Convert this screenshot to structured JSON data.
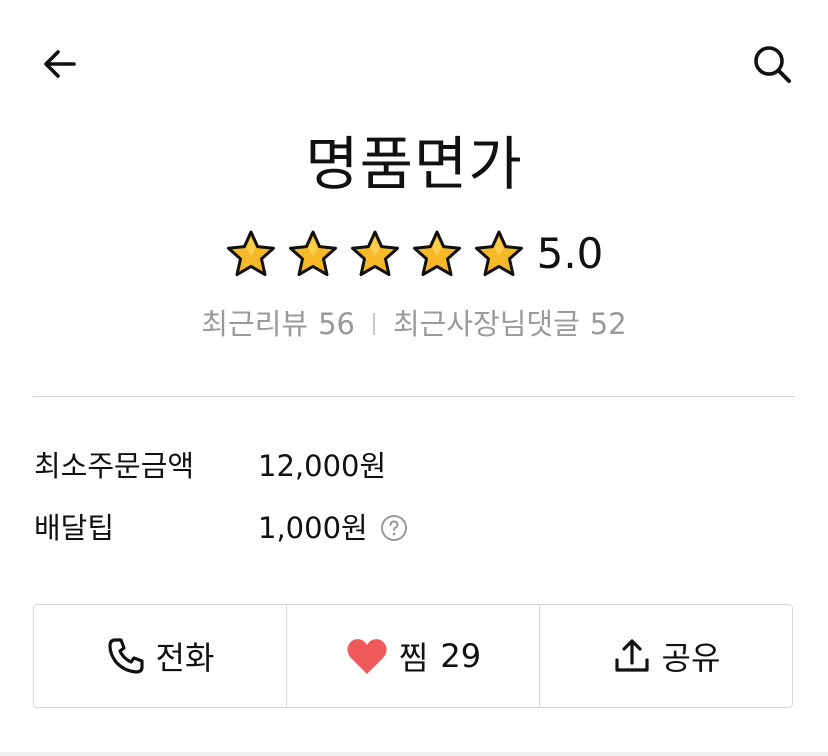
{
  "header": {
    "back_icon": "arrow-left-icon",
    "search_icon": "search-icon"
  },
  "store": {
    "name": "명품면가",
    "rating": 5.0,
    "rating_text": "5.0",
    "stars": 5,
    "star_color": "#f7b928"
  },
  "reviews": {
    "recent_label": "최근리뷰",
    "recent_count": "56",
    "owner_label": "최근사장님댓글",
    "owner_count": "52"
  },
  "info": {
    "min_order_label": "최소주문금액",
    "min_order_value": "12,000원",
    "delivery_tip_label": "배달팁",
    "delivery_tip_value": "1,000원",
    "help_icon": "question-circle-icon"
  },
  "actions": [
    {
      "label": "전화",
      "icon": "phone-icon"
    },
    {
      "label": "찜",
      "count": "29",
      "icon": "heart-icon",
      "color": "#f15a5a"
    },
    {
      "label": "공유",
      "icon": "share-upload-icon"
    }
  ]
}
